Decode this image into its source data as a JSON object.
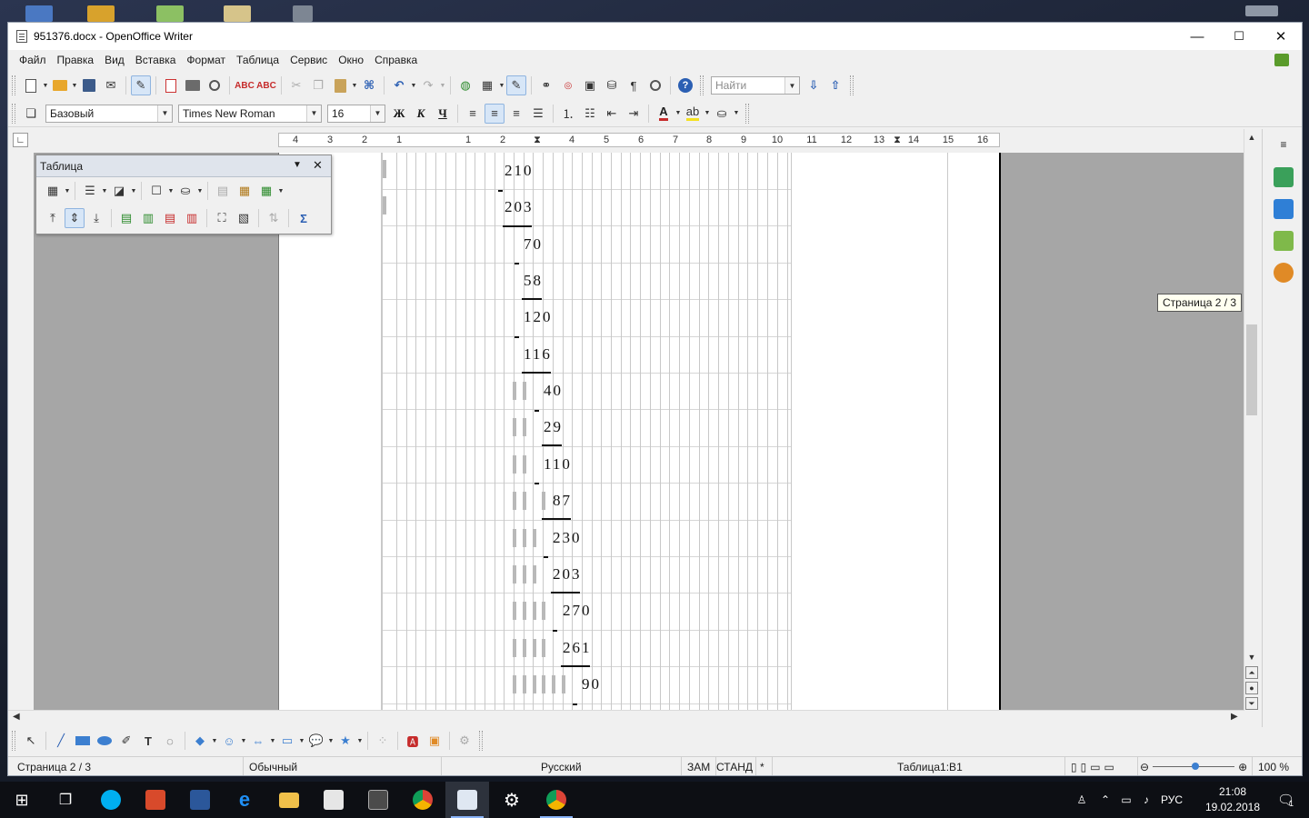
{
  "window": {
    "title": "951376.docx - OpenOffice Writer",
    "controls": {
      "minimize": "—",
      "maximize": "☐",
      "close": "✕"
    }
  },
  "menu": {
    "items": [
      "Файл",
      "Правка",
      "Вид",
      "Вставка",
      "Формат",
      "Таблица",
      "Сервис",
      "Окно",
      "Справка"
    ]
  },
  "toolbar": {
    "find_placeholder": "Найти"
  },
  "formatting": {
    "style": "Базовый",
    "font": "Times New Roman",
    "size": "16",
    "bold": "Ж",
    "italic": "К",
    "underline": "Ч"
  },
  "ruler": {
    "ticks": [
      "4",
      "3",
      "2",
      "1",
      "1",
      "2",
      "3",
      "4",
      "5",
      "6",
      "7",
      "8",
      "9",
      "10",
      "11",
      "12",
      "13",
      "14",
      "15",
      "16"
    ]
  },
  "table_toolbar": {
    "title": "Таблица"
  },
  "document": {
    "calc_numbers": [
      "210",
      "203",
      "70",
      "58",
      "120",
      "116",
      "40",
      "29",
      "110",
      "87",
      "230",
      "203",
      "270",
      "261",
      "90"
    ]
  },
  "tooltip": {
    "text": "Страница  2 / 3"
  },
  "status": {
    "page": "Страница  2 / 3",
    "style": "Обычный",
    "language": "Русский",
    "mode_insert": "ЗАМ",
    "mode_select": "СТАНД",
    "modified": "*",
    "cell": "Таблица1:B1",
    "zoom": "100 %"
  },
  "taskbar": {
    "lang": "РУС",
    "time": "21:08",
    "date": "19.02.2018",
    "notifications": "1"
  },
  "colors": {
    "accent": "#2b5fb3",
    "taskbar": "#0d0f14"
  }
}
